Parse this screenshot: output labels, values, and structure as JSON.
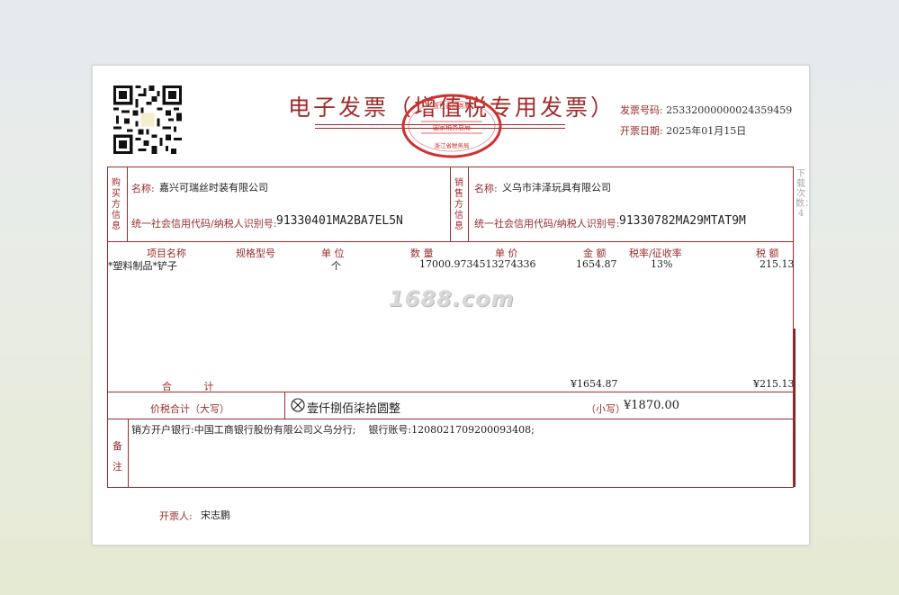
{
  "invoice": {
    "title": "电子发票（增值税专用发票）",
    "number_label": "发票号码:",
    "number": "25332000000024359459",
    "date_label": "开票日期:",
    "date": "2025年01月15日",
    "seal_top": "浙江省税务局",
    "seal_mid": "国家税务总局",
    "seal_bottom": "浙江省税务局",
    "seal_color": "#d03030"
  },
  "buyer": {
    "section_label": "购买方信息",
    "name_label": "名称:",
    "name": "嘉兴可瑞丝时装有限公司",
    "tax_label": "统一社会信用代码/纳税人识别号:",
    "tax_id": "91330401MA2BA7EL5N"
  },
  "seller": {
    "section_label": "销售方信息",
    "name_label": "名称:",
    "name": "义乌市沣泽玩具有限公司",
    "tax_label": "统一社会信用代码/纳税人识别号:",
    "tax_id": "91330782MA29MTAT9M"
  },
  "items": {
    "headers": {
      "name": "项目名称",
      "spec": "规格型号",
      "unit": "单 位",
      "qty": "数 量",
      "price": "单 价",
      "amount": "金 额",
      "rate": "税率/征收率",
      "tax": "税 额"
    },
    "rows": [
      {
        "name": "*塑料制品*铲子",
        "spec": "",
        "unit": "个",
        "qty": "1700",
        "price": "0.9734513274336",
        "amount": "1654.87",
        "rate": "13%",
        "tax": "215.13"
      }
    ],
    "total_label": "合 计",
    "total_amount": "¥1654.87",
    "total_tax": "¥215.13"
  },
  "summary": {
    "label": "价税合计（大写）",
    "upper_amount": "壹仟捌佰柒拾圆整",
    "small_label": "（小写）",
    "small_amount": "¥1870.00"
  },
  "remarks": {
    "label_1": "备",
    "label_2": "注",
    "line": "销方开户银行:中国工商银行股份有限公司义乌分行;    银行账号:1208021709200093408;"
  },
  "issuer": {
    "label": "开票人:",
    "name": "宋志鹏"
  },
  "watermark": "1688.com",
  "side_note": "下载次数：4",
  "colors": {
    "accent": "#a32a2a",
    "background_top": "#e6eaee",
    "background_bottom": "#e5ead2"
  }
}
